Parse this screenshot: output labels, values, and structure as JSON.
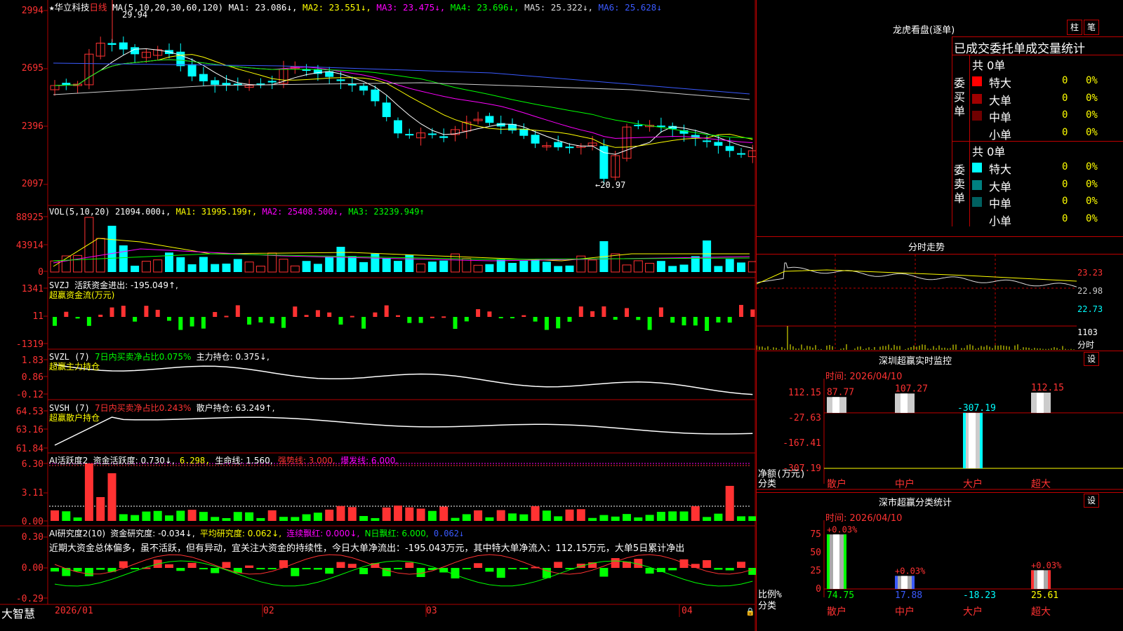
{
  "colors": {
    "up": "#ff3232",
    "down": "#00ffff",
    "grid": "#b00000",
    "ma1": "#ffffff",
    "ma2": "#ffff00",
    "ma3": "#ff00ff",
    "ma4": "#00ff00",
    "ma5": "#d0d0d0",
    "ma6": "#3a5aff"
  },
  "header": {
    "star_icon": "star-icon",
    "stock_name": "华立科技",
    "period": "日线",
    "ma_formula": "MA(5,10,20,30,60,120)",
    "ma1": "MA1: 23.086↓,",
    "ma2": "MA2: 23.551↓,",
    "ma3": "MA3: 23.475↓,",
    "ma4": "MA4: 23.696↓,",
    "ma5": "MA5: 25.322↓,",
    "ma6": "MA6: 25.628↓",
    "peak": "29.94",
    "trough": "←20.97"
  },
  "price_axis": [
    "2994",
    "2695",
    "2396",
    "2097"
  ],
  "vol": {
    "name": "VOL(5,10,20)",
    "value": "21094.000↓,",
    "ma1": "MA1: 31995.199↑,",
    "ma2": "MA2: 25408.500↓,",
    "ma3": "MA3: 23239.949↑",
    "axis": [
      "88925",
      "43914",
      "0"
    ]
  },
  "svzj": {
    "name": "SVZJ",
    "label": "活跃资金进出: -195.049↑,",
    "sub": "超赢资金流(万元)",
    "axis": [
      "1341",
      "11",
      "-1319"
    ]
  },
  "svzl": {
    "name": "SVZL (7)",
    "label1": "7日内买卖净占比0.075%",
    "label2": "主力持仓: 0.375↓,",
    "sub": "超赢主力持仓",
    "axis": [
      "1.83",
      "0.86",
      "-0.12"
    ]
  },
  "svsh": {
    "name": "SVSH (7)",
    "label1": "7日内买卖净占比0.243%",
    "label2": "散户持仓: 63.249↑,",
    "sub": "超赢散户持仓",
    "axis": [
      "64.53",
      "63.16",
      "61.84"
    ]
  },
  "ai1": {
    "name": "AI活跃度2",
    "label1": "资金活跃度: 0.730↓,",
    "label2": "6.298,",
    "label3": "生命线: 1.560,",
    "label4": "强势线: 3.000,",
    "label5": "爆发线: 6.000,",
    "axis": [
      "6.30",
      "3.11",
      "0.00"
    ]
  },
  "ai2": {
    "name": "AI研究度2(10)",
    "label1": "资金研究度: -0.034↓,",
    "label2": "平均研究度: 0.062↓,",
    "label3": "连续飘红: 0.000↓,",
    "label4": "N日飘红: 6.000,",
    "label5": "0.062↓",
    "commentary": "近期大资金总体偏多，虽不活跃，但有异动，宜关注大资金的持续性，今日大单净流出：-195.043万元，其中特大单净流入：112.15万元，大单5日累计净出",
    "axis": [
      "0.30",
      "0.00",
      "-0.29"
    ]
  },
  "date_axis": [
    "2026/01",
    "02",
    "03",
    "04"
  ],
  "brand": "大智慧",
  "lock_icon": "lock-icon",
  "right": {
    "lhb_title": "龙虎看盘(逐单)",
    "btn_zhu": "柱",
    "btn_bi": "笔",
    "tabs_title": "已成交委托单成交量统计",
    "buy_group": {
      "vertical": "委买单",
      "total": "共 0单",
      "rows": [
        {
          "label": "特大",
          "count": "0",
          "pct": "0%",
          "color": "#ff0000"
        },
        {
          "label": "大单",
          "count": "0",
          "pct": "0%",
          "color": "#a00000"
        },
        {
          "label": "中单",
          "count": "0",
          "pct": "0%",
          "color": "#700000"
        },
        {
          "label": "小单",
          "count": "0",
          "pct": "0%",
          "color": "#000000"
        }
      ]
    },
    "sell_group": {
      "vertical": "委卖单",
      "total": "共 0单",
      "rows": [
        {
          "label": "特大",
          "count": "0",
          "pct": "0%",
          "color": "#00ffff"
        },
        {
          "label": "大单",
          "count": "0",
          "pct": "0%",
          "color": "#008080"
        },
        {
          "label": "中单",
          "count": "0",
          "pct": "0%",
          "color": "#006060"
        },
        {
          "label": "小单",
          "count": "0",
          "pct": "0%",
          "color": "#000000"
        }
      ]
    },
    "intraday": {
      "title": "分时走势",
      "axis": [
        "23.23",
        "22.98",
        "22.73"
      ],
      "vol_max": "1103",
      "vol_unit": "分时"
    },
    "monitor": {
      "title": "深圳超赢实时监控",
      "btn": "设",
      "time": "时间: 2026/04/10",
      "axis": [
        "112.15",
        "-27.63",
        "-167.41",
        "-307.19"
      ],
      "ylabel": "净额(万元)",
      "xlabel": "分类",
      "bars": [
        {
          "cat": "散户",
          "value": 87.77,
          "label": "87.77"
        },
        {
          "cat": "中户",
          "value": 107.27,
          "label": "107.27"
        },
        {
          "cat": "大户",
          "value": -307.19,
          "label": "-307.19"
        },
        {
          "cat": "超大",
          "value": 112.15,
          "label": "112.15"
        }
      ]
    },
    "classify": {
      "title": "深市超赢分类统计",
      "btn": "设",
      "time": "时间: 2026/04/10",
      "axis": [
        "75",
        "50",
        "25",
        "0"
      ],
      "ylabel": "比例%",
      "xlabel": "分类",
      "bars": [
        {
          "cat": "散户",
          "value": 74.75,
          "label": "74.75",
          "top": "+0.03%"
        },
        {
          "cat": "中户",
          "value": 17.88,
          "label": "17.88",
          "top": "+0.03%"
        },
        {
          "cat": "大户",
          "value": -18.23,
          "label": "-18.23",
          "top": ""
        },
        {
          "cat": "超大",
          "value": 25.61,
          "label": "25.61",
          "top": "+0.03%"
        }
      ]
    }
  }
}
